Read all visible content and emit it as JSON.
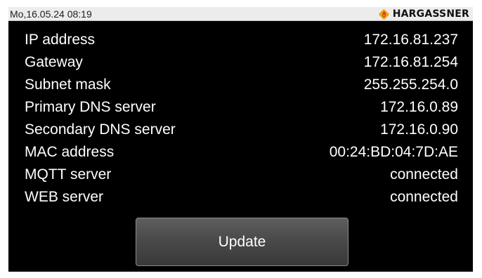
{
  "status_bar": {
    "datetime": "Mo,16.05.24 08:19",
    "brand": "HARGASSNER",
    "logo_icon": "hargassner-flame-logo",
    "logo_color": "#f2a200"
  },
  "network_info": [
    {
      "label": "IP address",
      "value": "172.16.81.237"
    },
    {
      "label": "Gateway",
      "value": "172.16.81.254"
    },
    {
      "label": "Subnet mask",
      "value": "255.255.254.0"
    },
    {
      "label": "Primary DNS server",
      "value": "172.16.0.89"
    },
    {
      "label": "Secondary DNS server",
      "value": "172.16.0.90"
    },
    {
      "label": "MAC address",
      "value": "00:24:BD:04:7D:AE"
    },
    {
      "label": "MQTT server",
      "value": "connected"
    },
    {
      "label": "WEB server",
      "value": "connected"
    }
  ],
  "update_button": {
    "label": "Update"
  },
  "colors": {
    "screen_background": "#000000",
    "status_bar_background": "#ececec",
    "text": "#ffffff"
  }
}
